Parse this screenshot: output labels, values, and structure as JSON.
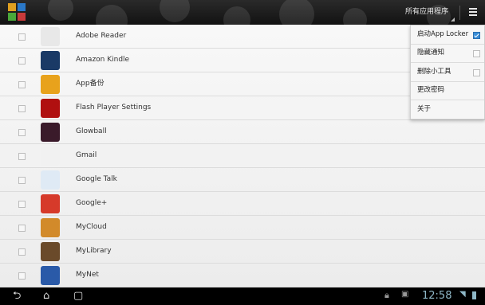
{
  "actionbar": {
    "filter_label": "所有应用程序"
  },
  "apps": [
    {
      "name": "Adobe Reader",
      "icon": "adobe-reader-icon",
      "color": "#e8e8e8",
      "glyph": "⅄",
      "glyph_color": "#d22a1f"
    },
    {
      "name": "Amazon Kindle",
      "icon": "kindle-icon",
      "color": "#1a3a66",
      "glyph": "kindle",
      "glyph_color": "#ffffff"
    },
    {
      "name": "App备份",
      "icon": "app-backup-icon",
      "color": "#e8a21c",
      "glyph": "◉",
      "glyph_color": "#2a5a8a"
    },
    {
      "name": "Flash Player Settings",
      "icon": "flash-player-icon",
      "color": "#b01010",
      "glyph": "f",
      "glyph_color": "#ffffff"
    },
    {
      "name": "Glowball",
      "icon": "glowball-icon",
      "color": "#3a1a2a",
      "glyph": "●",
      "glyph_color": "#e0507a"
    },
    {
      "name": "Gmail",
      "icon": "gmail-icon",
      "color": "#f1f1f1",
      "glyph": "M",
      "glyph_color": "#d23a2a"
    },
    {
      "name": "Google Talk",
      "icon": "google-talk-icon",
      "color": "#dfeaf5",
      "glyph": "talk",
      "glyph_color": "#2a6aa8"
    },
    {
      "name": "Google+",
      "icon": "google-plus-icon",
      "color": "#d63a2a",
      "glyph": "g+",
      "glyph_color": "#ffffff"
    },
    {
      "name": "MyCloud",
      "icon": "mycloud-icon",
      "color": "#d28a2a",
      "glyph": "☁",
      "glyph_color": "#4aa8e0"
    },
    {
      "name": "MyLibrary",
      "icon": "mylibrary-icon",
      "color": "#6a4a2a",
      "glyph": "▤",
      "glyph_color": "#e8d2a0"
    },
    {
      "name": "MyNet",
      "icon": "mynet-icon",
      "color": "#2a5aa8",
      "glyph": "▣",
      "glyph_color": "#dfeaf5"
    }
  ],
  "menu": [
    {
      "label": "启动App Locker",
      "has_check": true,
      "checked": true
    },
    {
      "label": "隐藏通知",
      "has_check": true,
      "checked": false
    },
    {
      "label": "删除小工具",
      "has_check": true,
      "checked": false
    },
    {
      "label": "更改密码",
      "has_check": false,
      "checked": false
    },
    {
      "label": "关于",
      "has_check": false,
      "checked": false
    }
  ],
  "status": {
    "time": "12:58"
  },
  "colors": {
    "accent": "#3a8fd8",
    "actionbar": "#1c1c1c",
    "clock": "#8fb8c8"
  }
}
